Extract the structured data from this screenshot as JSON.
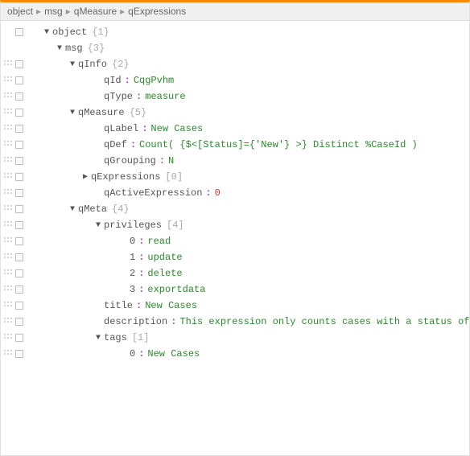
{
  "breadcrumb": [
    "object",
    "msg",
    "qMeasure",
    "qExpressions"
  ],
  "rows": [
    {
      "indent": 1,
      "gutter": "box",
      "toggle": "down",
      "key": "object",
      "meta": "{1}"
    },
    {
      "indent": 2,
      "gutter": "none",
      "toggle": "down",
      "key": "msg",
      "meta": "{3}"
    },
    {
      "indent": 3,
      "gutter": "both",
      "toggle": "down",
      "key": "qInfo",
      "meta": "{2}"
    },
    {
      "indent": 5,
      "gutter": "both",
      "toggle": "",
      "key": "qId",
      "sep": ":",
      "val": "CqgPvhm",
      "vtype": "str"
    },
    {
      "indent": 5,
      "gutter": "both",
      "toggle": "",
      "key": "qType",
      "sep": ":",
      "val": "measure",
      "vtype": "str"
    },
    {
      "indent": 3,
      "gutter": "both",
      "toggle": "down",
      "key": "qMeasure",
      "meta": "{5}"
    },
    {
      "indent": 5,
      "gutter": "both",
      "toggle": "",
      "key": "qLabel",
      "sep": ":",
      "val": "New Cases",
      "vtype": "str"
    },
    {
      "indent": 5,
      "gutter": "both",
      "toggle": "",
      "key": "qDef",
      "sep": ":",
      "val": "Count( {$<[Status]={'New'} >} Distinct %CaseId )",
      "vtype": "str"
    },
    {
      "indent": 5,
      "gutter": "both",
      "toggle": "",
      "key": "qGrouping",
      "sep": ":",
      "val": "N",
      "vtype": "str"
    },
    {
      "indent": 4,
      "gutter": "both",
      "toggle": "right",
      "key": "qExpressions",
      "meta": "[0]"
    },
    {
      "indent": 5,
      "gutter": "both",
      "toggle": "",
      "key": "qActiveExpression",
      "sep": ":",
      "val": "0",
      "vtype": "num"
    },
    {
      "indent": 3,
      "gutter": "both",
      "toggle": "down",
      "key": "qMeta",
      "meta": "{4}"
    },
    {
      "indent": 5,
      "gutter": "both",
      "toggle": "down",
      "key": "privileges",
      "meta": "[4]"
    },
    {
      "indent": 7,
      "gutter": "both",
      "toggle": "",
      "key": "0",
      "sep": ":",
      "val": "read",
      "vtype": "str"
    },
    {
      "indent": 7,
      "gutter": "both",
      "toggle": "",
      "key": "1",
      "sep": ":",
      "val": "update",
      "vtype": "str"
    },
    {
      "indent": 7,
      "gutter": "both",
      "toggle": "",
      "key": "2",
      "sep": ":",
      "val": "delete",
      "vtype": "str"
    },
    {
      "indent": 7,
      "gutter": "both",
      "toggle": "",
      "key": "3",
      "sep": ":",
      "val": "exportdata",
      "vtype": "str"
    },
    {
      "indent": 5,
      "gutter": "both",
      "toggle": "",
      "key": "title",
      "sep": ":",
      "val": "New Cases",
      "vtype": "str"
    },
    {
      "indent": 5,
      "gutter": "both",
      "toggle": "",
      "key": "description",
      "sep": ":",
      "val": "This expression only counts cases with a status of New.",
      "vtype": "str"
    },
    {
      "indent": 5,
      "gutter": "both",
      "toggle": "down",
      "key": "tags",
      "meta": "[1]"
    },
    {
      "indent": 7,
      "gutter": "both",
      "toggle": "",
      "key": "0",
      "sep": ":",
      "val": "New Cases",
      "vtype": "str"
    }
  ]
}
